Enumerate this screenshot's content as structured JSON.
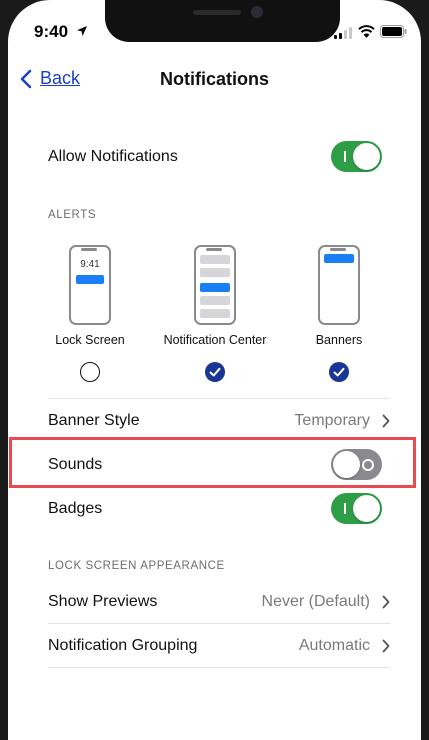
{
  "status_bar": {
    "time": "9:40"
  },
  "nav": {
    "back_label": "Back",
    "title": "Notifications"
  },
  "allow_notifications": {
    "label": "Allow Notifications",
    "state": "on"
  },
  "alerts": {
    "section_header": "ALERTS",
    "preview_time": "9:41",
    "options": [
      {
        "label": "Lock Screen",
        "selected": false
      },
      {
        "label": "Notification Center",
        "selected": true
      },
      {
        "label": "Banners",
        "selected": true
      }
    ]
  },
  "banner_style": {
    "label": "Banner Style",
    "value": "Temporary"
  },
  "sounds": {
    "label": "Sounds",
    "state": "off"
  },
  "badges": {
    "label": "Badges",
    "state": "on"
  },
  "lock_screen_appearance": {
    "section_header": "LOCK SCREEN APPEARANCE",
    "show_previews": {
      "label": "Show Previews",
      "value": "Never (Default)"
    },
    "notification_grouping": {
      "label": "Notification Grouping",
      "value": "Automatic"
    }
  },
  "colors": {
    "accent_link": "#1a3fc7",
    "toggle_on": "#2e9e46",
    "toggle_off": "#8a8a8e",
    "radio_selected": "#1a3596",
    "highlight_border": "#e84a4f",
    "notification_blue": "#1a7ff5"
  },
  "icons": [
    "location-arrow-icon",
    "cellular-signal-icon",
    "wifi-icon",
    "battery-icon",
    "chevron-left-icon",
    "chevron-right-icon",
    "checkmark-icon"
  ]
}
